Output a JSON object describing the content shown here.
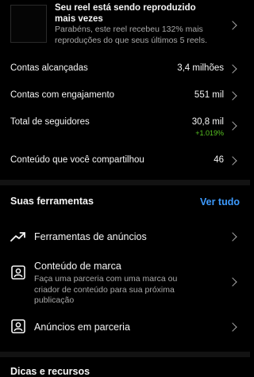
{
  "reel_card": {
    "title": "Seu reel está sendo reproduzido mais vezes",
    "description": "Parabéns, este reel recebeu 132% mais reproduções do que seus últimos 5 reels."
  },
  "stats": [
    {
      "label": "Contas alcançadas",
      "value": "3,4 milhões"
    },
    {
      "label": "Contas com engajamento",
      "value": "551 mil"
    },
    {
      "label": "Total de seguidores",
      "value": "30,8 mil",
      "delta": "+1.019%"
    },
    {
      "label": "Conteúdo que você compartilhou",
      "value": "46"
    }
  ],
  "tools_section": {
    "title": "Suas ferramentas",
    "see_all": "Ver tudo",
    "items": [
      {
        "label": "Ferramentas de anúncios",
        "icon": "trending-up-icon"
      },
      {
        "label": "Conteúdo de marca",
        "description": "Faça uma parceria com uma marca ou criador de conteúdo para sua próxima publicação",
        "icon": "branded-content-icon"
      },
      {
        "label": "Anúncios em parceria",
        "icon": "partnership-ads-icon"
      }
    ]
  },
  "tips_section": {
    "title": "Dicas e recursos"
  },
  "colors": {
    "background": "#000000",
    "primary_text": "#f5f5f5",
    "secondary_text": "#a8a8a8",
    "accent_link": "#3d9bff",
    "positive_delta": "#58c322"
  }
}
